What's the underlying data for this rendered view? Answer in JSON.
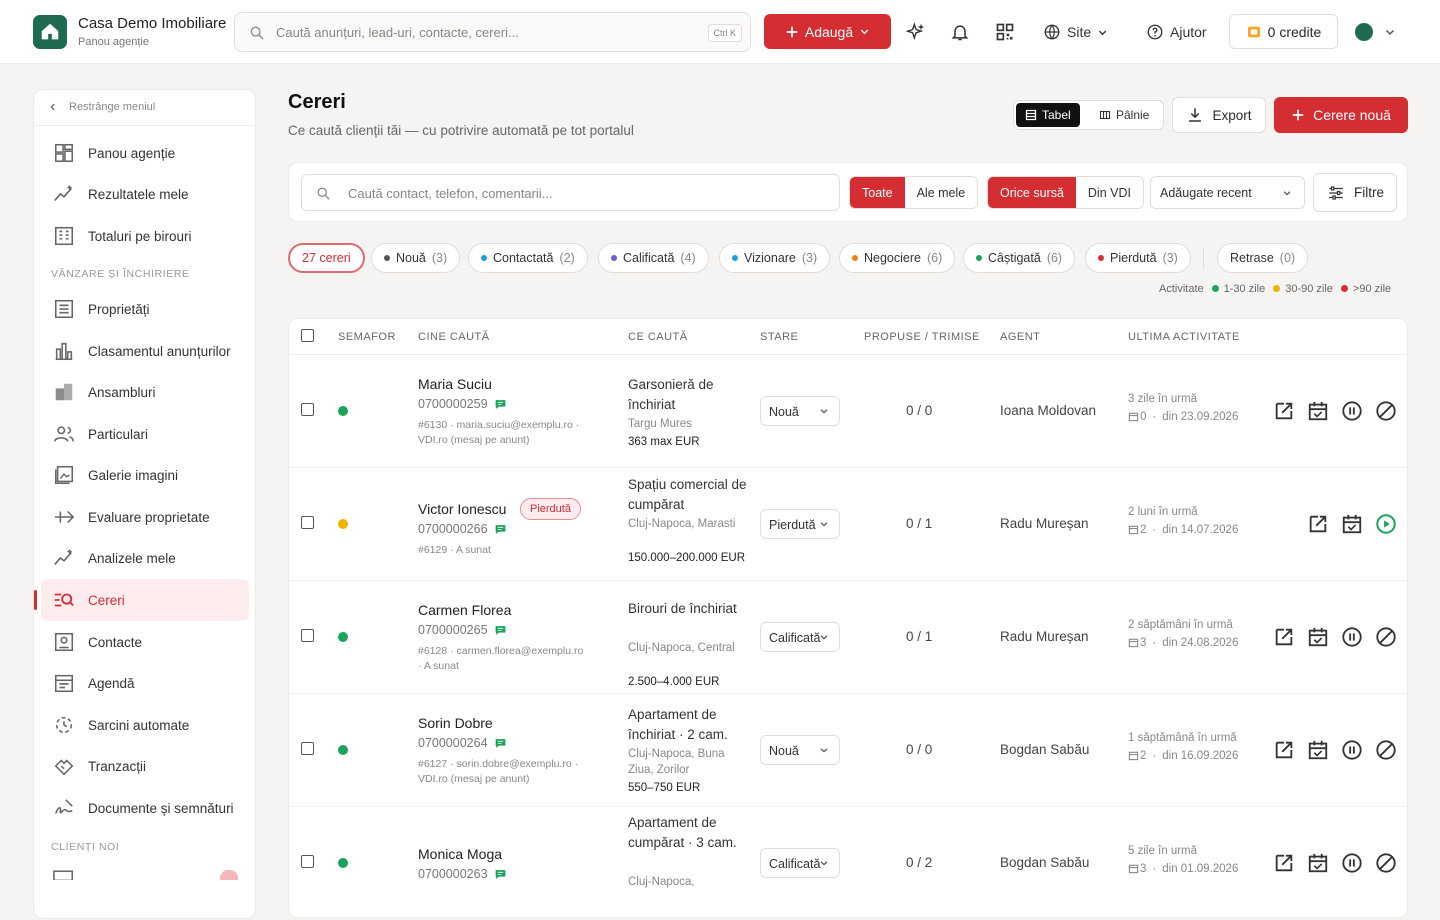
{
  "header": {
    "brand_name": "Casa Demo Imobiliare",
    "brand_sub": "Panou agenție",
    "search_placeholder": "Caută anunțuri, lead-uri, contacte, cereri...",
    "search_shortcut": "Ctrl K",
    "add_label": "Adaugă",
    "site_label": "Site",
    "help_label": "Ajutor",
    "credits_label": "0 credite"
  },
  "sidebar": {
    "collapse_label": "Restrânge meniul",
    "items_top": [
      "Panou agenție",
      "Rezultatele mele",
      "Totaluri pe birouri"
    ],
    "section_sales": "VÂNZARE ȘI ÎNCHIRIERE",
    "items_sales": [
      "Proprietăți",
      "Clasamentul anunțurilor",
      "Ansambluri",
      "Particulari",
      "Galerie imagini",
      "Evaluare proprietate",
      "Analizele mele",
      "Cereri",
      "Contacte",
      "Agendă",
      "Sarcini automate",
      "Tranzacții",
      "Documente și semnături"
    ],
    "section_new": "CLIENȚI NOI"
  },
  "page": {
    "title": "Cereri",
    "subtitle": "Ce caută clienții tăi — cu potrivire automată pe tot portalul",
    "view_table": "Tabel",
    "view_funnel": "Pâlnie",
    "export_label": "Export",
    "new_label": "Cerere nouă"
  },
  "filters": {
    "search_placeholder": "Caută contact, telefon, comentarii...",
    "scope_all": "Toate",
    "scope_mine": "Ale mele",
    "source_any": "Orice sursă",
    "source_vdi": "Din VDI",
    "sort_label": "Adăugate recent",
    "filters_label": "Filtre"
  },
  "chips": [
    {
      "label": "27 cereri",
      "count": "",
      "color": ""
    },
    {
      "label": "Nouă",
      "count": "(3)",
      "color": "#555555"
    },
    {
      "label": "Contactată",
      "count": "(2)",
      "color": "#1a9fd6"
    },
    {
      "label": "Calificată",
      "count": "(4)",
      "color": "#6a5bd6"
    },
    {
      "label": "Vizionare",
      "count": "(3)",
      "color": "#1a9fd6"
    },
    {
      "label": "Negociere",
      "count": "(6)",
      "color": "#e8841a"
    },
    {
      "label": "Câștigată",
      "count": "(6)",
      "color": "#1aa35a"
    },
    {
      "label": "Pierdută",
      "count": "(3)",
      "color": "#d42d32"
    },
    {
      "label": "Retrase",
      "count": "(0)",
      "color": ""
    }
  ],
  "legend": {
    "title": "Activitate",
    "items": [
      {
        "label": "1-30 zile",
        "color": "#1aa35a"
      },
      {
        "label": "30-90 zile",
        "color": "#f0b400"
      },
      {
        "label": ">90 zile",
        "color": "#d42d32"
      }
    ]
  },
  "table": {
    "headers": [
      "SEMAFOR",
      "CINE CAUTĂ",
      "CE CAUTĂ",
      "STARE",
      "PROPUSE / TRIMISE",
      "AGENT",
      "ULTIMA ACTIVITATE"
    ],
    "rows": [
      {
        "semafor": "#1aa35a",
        "name": "Maria Suciu",
        "badge": "",
        "phone": "0700000259",
        "meta1": "#6130 · maria.suciu@exemplu.ro ·",
        "meta2": "VDI.ro (mesaj pe anunt)",
        "what": "Garsonieră de închiriat",
        "where": "Targu Mures",
        "budget": "363 max EUR",
        "status": "Nouă",
        "ratio": "0 / 0",
        "agent": "Ioana Moldovan",
        "last": "3 zile în urmă",
        "count": "0",
        "since": "din 23.09.2026",
        "paused": false
      },
      {
        "semafor": "#f0b400",
        "name": "Victor Ionescu",
        "badge": "Pierdută",
        "phone": "0700000266",
        "meta1": "#6129 · A sunat",
        "meta2": "",
        "what": "Spațiu comercial de cumpărat",
        "where": "Cluj-Napoca, Marasti",
        "budget": "150.000–200.000 EUR",
        "status": "Pierdută",
        "ratio": "0 / 1",
        "agent": "Radu Mureșan",
        "last": "2 luni în urmă",
        "count": "2",
        "since": "din 14.07.2026",
        "paused": true
      },
      {
        "semafor": "#1aa35a",
        "name": "Carmen Florea",
        "badge": "",
        "phone": "0700000265",
        "meta1": "#6128 · carmen.florea@exemplu.ro",
        "meta2": "· A sunat",
        "what": "Birouri de închiriat",
        "where": "Cluj-Napoca, Central",
        "budget": "2.500–4.000 EUR",
        "status": "Calificată",
        "ratio": "0 / 1",
        "agent": "Radu Mureșan",
        "last": "2 săptămâni în urmă",
        "count": "3",
        "since": "din 24.08.2026",
        "paused": false
      },
      {
        "semafor": "#1aa35a",
        "name": "Sorin Dobre",
        "badge": "",
        "phone": "0700000264",
        "meta1": "#6127 · sorin.dobre@exemplu.ro ·",
        "meta2": "VDI.ro (mesaj pe anunt)",
        "what": "Apartament de închiriat · 2 cam.",
        "where": "Cluj-Napoca, Buna Ziua, Zorilor",
        "budget": "550–750 EUR",
        "status": "Nouă",
        "ratio": "0 / 0",
        "agent": "Bogdan Sabău",
        "last": "1 săptămână în urmă",
        "count": "2",
        "since": "din 16.09.2026",
        "paused": false
      },
      {
        "semafor": "#1aa35a",
        "name": "Monica Moga",
        "badge": "",
        "phone": "0700000263",
        "meta1": "",
        "meta2": "",
        "what": "Apartament de cumpărat · 3 cam.",
        "where": "Cluj-Napoca,",
        "budget": "",
        "status": "Calificată",
        "ratio": "0 / 2",
        "agent": "Bogdan Sabău",
        "last": "5 zile în urmă",
        "count": "3",
        "since": "din 01.09.2026",
        "paused": false
      }
    ]
  }
}
